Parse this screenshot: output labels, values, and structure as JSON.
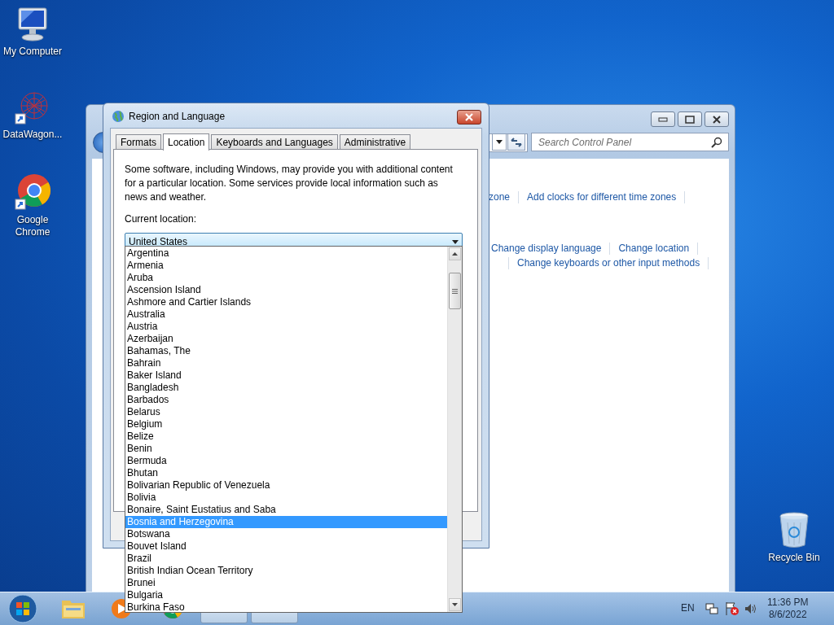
{
  "desktop_icons": [
    {
      "label": "My Computer",
      "kind": "computer"
    },
    {
      "label": "DataWagon...",
      "kind": "network"
    },
    {
      "label": "Google Chrome",
      "kind": "browser"
    },
    {
      "label": "Recycle Bin",
      "kind": "bin"
    }
  ],
  "control_panel": {
    "search": {
      "placeholder": "Search Control Panel"
    },
    "link_rows": [
      [
        "zone",
        "Add clocks for different time zones"
      ],
      [
        "Change display language",
        "Change location"
      ],
      [
        "Change keyboards or other input methods"
      ]
    ]
  },
  "dialog": {
    "title": "Region and Language",
    "tabs": [
      {
        "label": "Formats",
        "selected": false
      },
      {
        "label": "Location",
        "selected": true
      },
      {
        "label": "Keyboards and Languages",
        "selected": false
      },
      {
        "label": "Administrative",
        "selected": false
      }
    ],
    "description": "Some software, including Windows, may provide you with additional content for a particular location. Some services provide local information such as news and weather.",
    "location_label": "Current location:",
    "location_select": {
      "value": "United States",
      "expanded": true
    },
    "options": [
      {
        "label": "Argentina",
        "selected": false
      },
      {
        "label": "Armenia",
        "selected": false
      },
      {
        "label": "Aruba",
        "selected": false
      },
      {
        "label": "Ascension Island",
        "selected": false
      },
      {
        "label": "Ashmore and Cartier Islands",
        "selected": false
      },
      {
        "label": "Australia",
        "selected": false
      },
      {
        "label": "Austria",
        "selected": false
      },
      {
        "label": "Azerbaijan",
        "selected": false
      },
      {
        "label": "Bahamas, The",
        "selected": false
      },
      {
        "label": "Bahrain",
        "selected": false
      },
      {
        "label": "Baker Island",
        "selected": false
      },
      {
        "label": "Bangladesh",
        "selected": false
      },
      {
        "label": "Barbados",
        "selected": false
      },
      {
        "label": "Belarus",
        "selected": false
      },
      {
        "label": "Belgium",
        "selected": false
      },
      {
        "label": "Belize",
        "selected": false
      },
      {
        "label": "Benin",
        "selected": false
      },
      {
        "label": "Bermuda",
        "selected": false
      },
      {
        "label": "Bhutan",
        "selected": false
      },
      {
        "label": "Bolivarian Republic of Venezuela",
        "selected": false
      },
      {
        "label": "Bolivia",
        "selected": false
      },
      {
        "label": "Bonaire, Saint Eustatius and Saba",
        "selected": false
      },
      {
        "label": "Bosnia and Herzegovina",
        "selected": true
      },
      {
        "label": "Botswana",
        "selected": false
      },
      {
        "label": "Bouvet Island",
        "selected": false
      },
      {
        "label": "Brazil",
        "selected": false
      },
      {
        "label": "British Indian Ocean Territory",
        "selected": false
      },
      {
        "label": "Brunei",
        "selected": false
      },
      {
        "label": "Bulgaria",
        "selected": false
      },
      {
        "label": "Burkina Faso",
        "selected": false
      }
    ]
  },
  "taskbar": {
    "language": "EN",
    "time": "11:36 PM",
    "date": "8/6/2022"
  }
}
